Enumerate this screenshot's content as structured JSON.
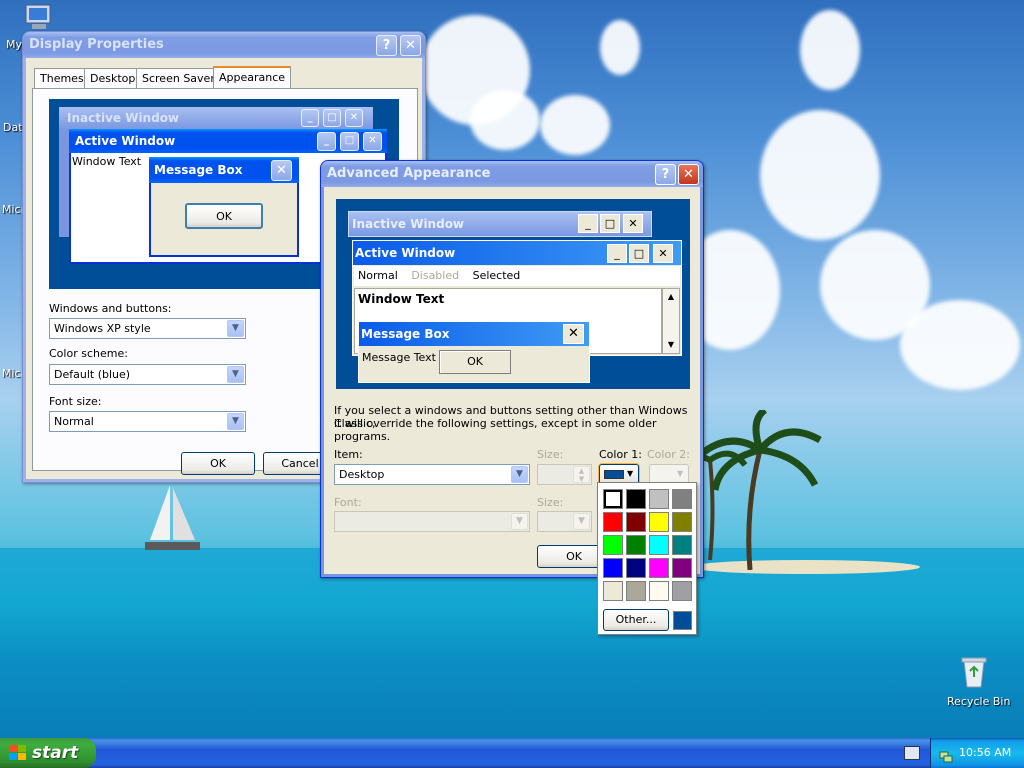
{
  "desktop": {
    "icons": [
      {
        "label": "My"
      },
      {
        "label": "Date"
      },
      {
        "label": "Micro"
      },
      {
        "label": "Micro"
      },
      {
        "label": "Recycle Bin"
      }
    ]
  },
  "display_properties": {
    "title": "Display Properties",
    "tabs": [
      "Themes",
      "Desktop",
      "Screen Saver",
      "Appearance"
    ],
    "selected_tab": "Appearance",
    "preview": {
      "inactive_title": "Inactive Window",
      "active_title": "Active Window",
      "window_text": "Window Text",
      "msgbox_title": "Message Box",
      "msgbox_ok": "OK"
    },
    "windows_buttons_label": "Windows and buttons:",
    "windows_buttons_value": "Windows XP style",
    "color_scheme_label": "Color scheme:",
    "color_scheme_value": "Default (blue)",
    "font_size_label": "Font size:",
    "font_size_value": "Normal",
    "ok": "OK",
    "cancel": "Cancel"
  },
  "advanced": {
    "title": "Advanced Appearance",
    "preview": {
      "inactive_title": "Inactive Window",
      "active_title": "Active Window",
      "menu_normal": "Normal",
      "menu_disabled": "Disabled",
      "menu_selected": "Selected",
      "window_text": "Window Text",
      "msgbox_title": "Message Box",
      "msgbox_text": "Message Text",
      "msgbox_ok": "OK"
    },
    "info_line1": "If you select a windows and buttons setting other than Windows Classic,",
    "info_line2": "it will override the following settings, except in some older programs.",
    "item_label": "Item:",
    "item_value": "Desktop",
    "size_label": "Size:",
    "color1_label": "Color 1:",
    "color2_label": "Color 2:",
    "font_label": "Font:",
    "font_size_label": "Size:",
    "ok": "OK",
    "color1_value": "#004e98"
  },
  "color_picker": {
    "colors": [
      "#ffffff",
      "#000000",
      "#c0c0c0",
      "#808080",
      "#ff0000",
      "#800000",
      "#ffff00",
      "#808000",
      "#00ff00",
      "#008000",
      "#00ffff",
      "#008080",
      "#0000ff",
      "#000080",
      "#ff00ff",
      "#800080",
      "#ece9d8",
      "#aca899",
      "#fffbf0",
      "#a0a0a4"
    ],
    "other_label": "Other...",
    "custom_color": "#004e98"
  },
  "taskbar": {
    "start_label": "start",
    "clock": "10:56 AM"
  }
}
